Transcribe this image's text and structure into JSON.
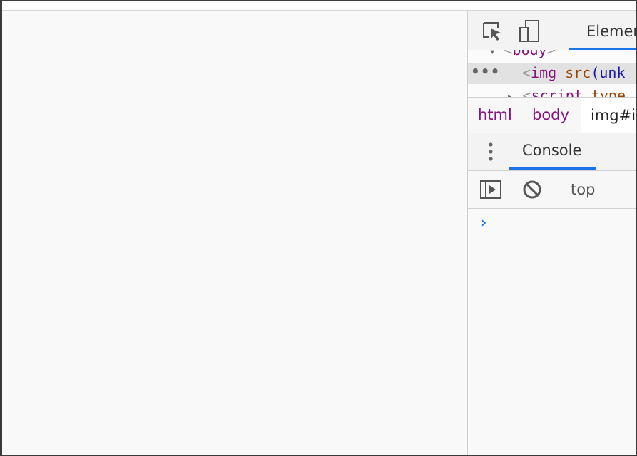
{
  "devtools": {
    "main_tab_label": "Elements",
    "dom": {
      "body_line": {
        "open": "<",
        "tag": "body",
        "close": ">"
      },
      "img_line": {
        "open": "<",
        "tag": "img",
        "attr": "src",
        "value_fragment": "(unk"
      },
      "script_line": {
        "open": "<",
        "tag": "script",
        "attr": "type"
      }
    },
    "breadcrumbs": [
      "html",
      "body",
      "img#i"
    ],
    "drawer_tab_label": "Console",
    "context_selector": "top",
    "console_prompt": "›"
  },
  "colors": {
    "accent": "#1a73e8",
    "tag": "#881280",
    "attribute": "#994500",
    "attribute_value": "#1a1aa6",
    "selected_row": "#e2e2e2"
  }
}
